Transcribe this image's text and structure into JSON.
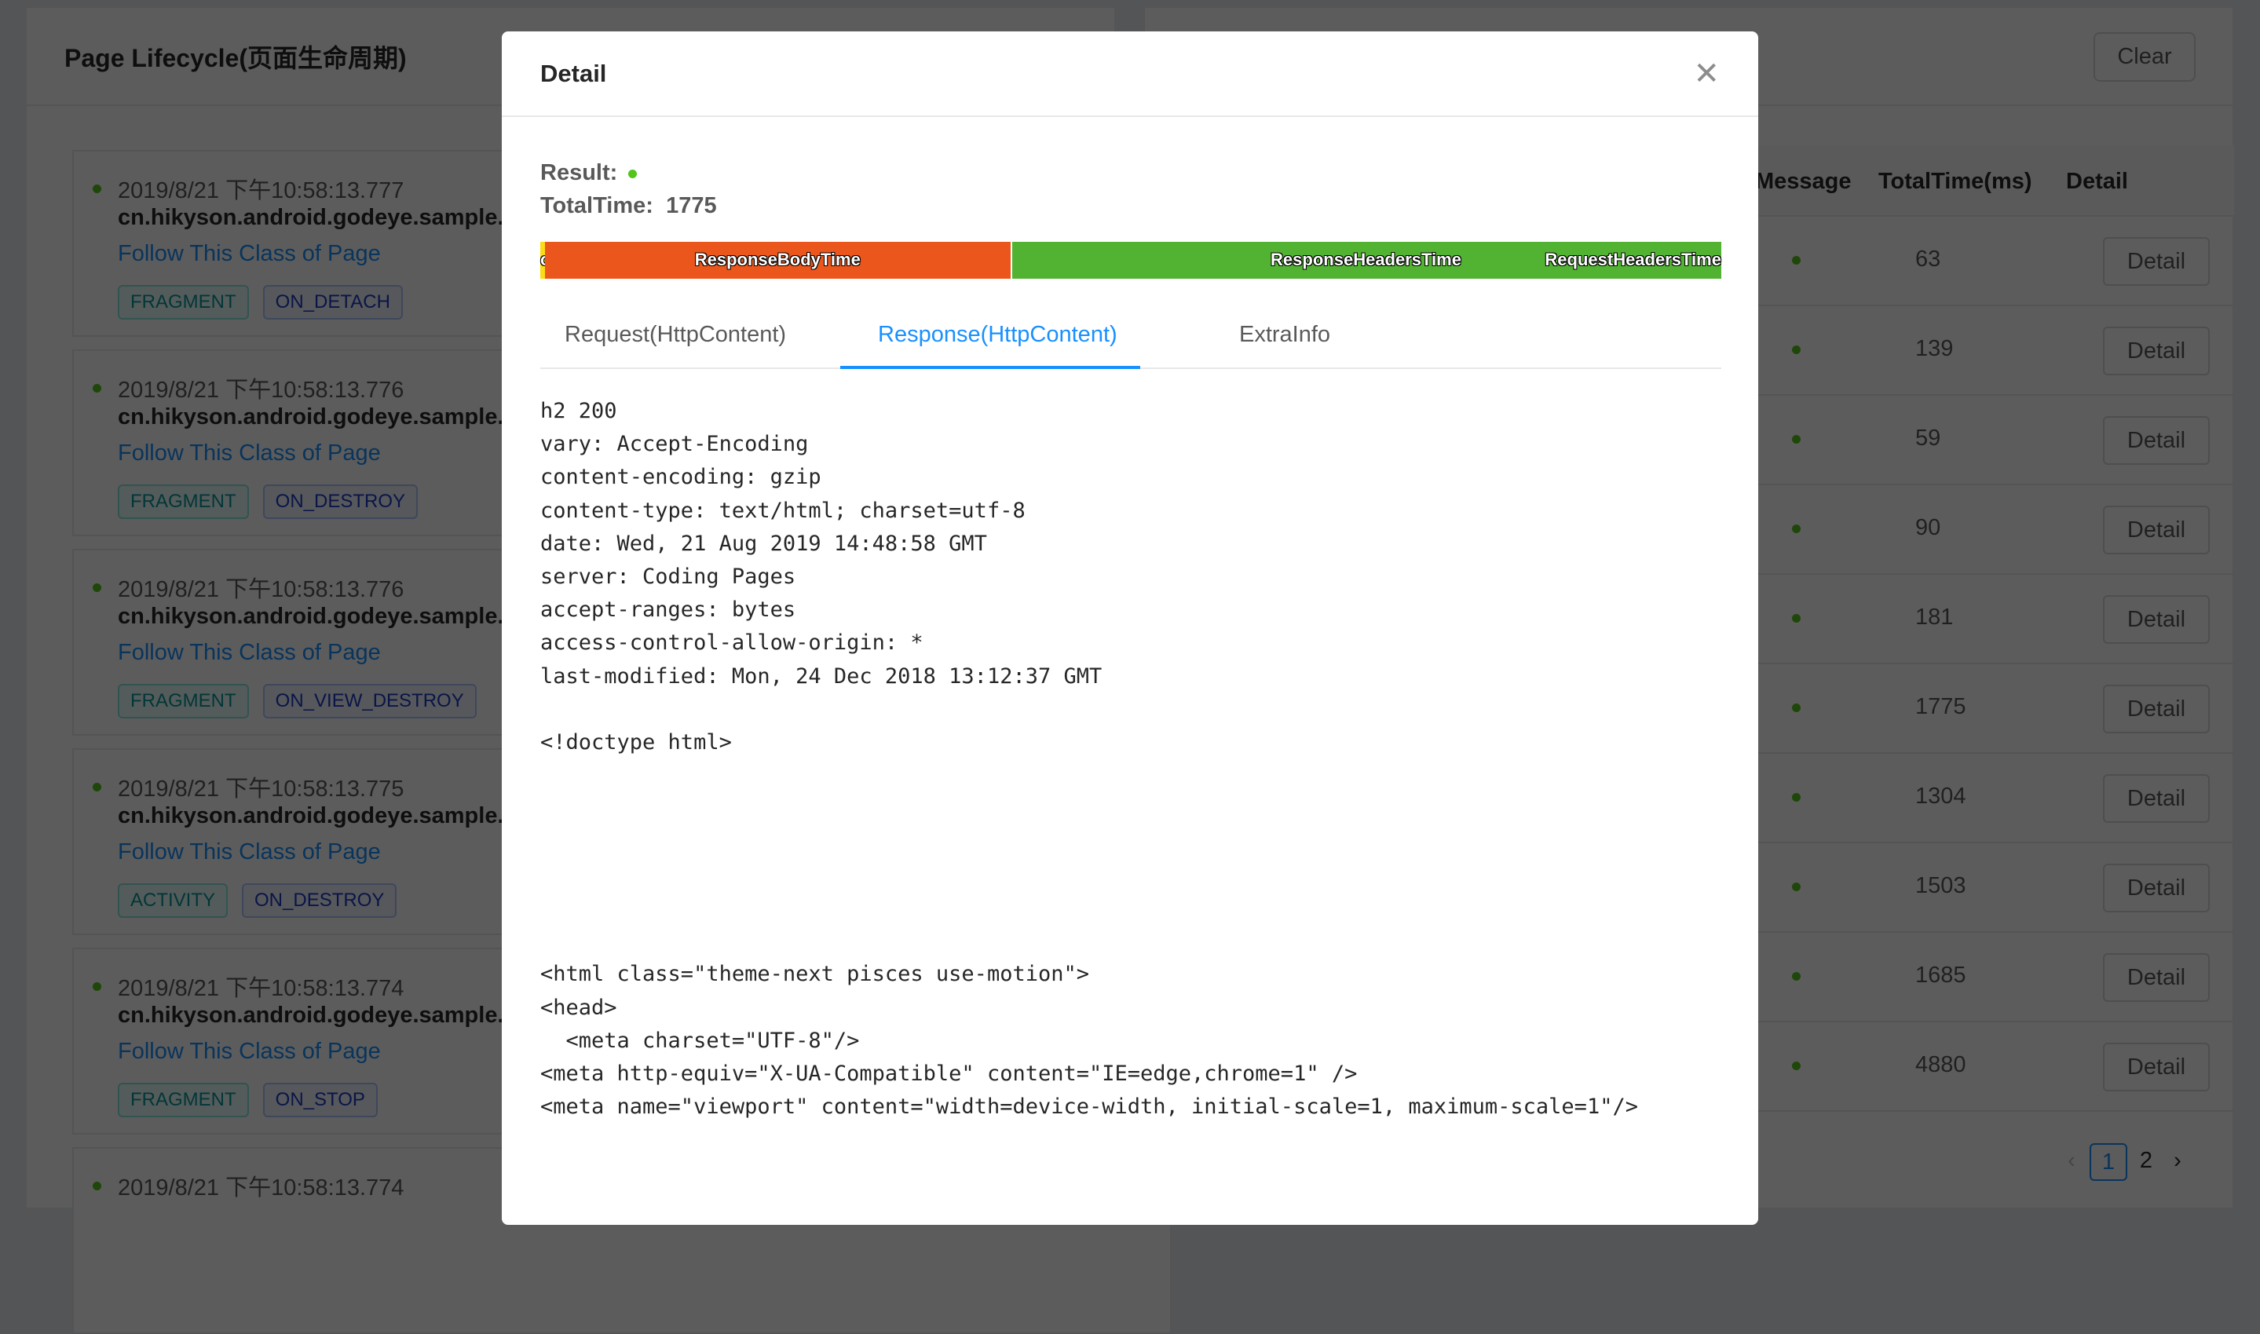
{
  "left_panel": {
    "title": "Page Lifecycle(页面生命周期)",
    "items": [
      {
        "time": "2019/8/21 下午10:58:13.777",
        "class": "cn.hikyson.android.godeye.sample.",
        "link": "Follow This Class of Page",
        "type": "FRAGMENT",
        "event": "ON_DETACH"
      },
      {
        "time": "2019/8/21 下午10:58:13.776",
        "class": "cn.hikyson.android.godeye.sample.",
        "link": "Follow This Class of Page",
        "type": "FRAGMENT",
        "event": "ON_DESTROY"
      },
      {
        "time": "2019/8/21 下午10:58:13.776",
        "class": "cn.hikyson.android.godeye.sample.",
        "link": "Follow This Class of Page",
        "type": "FRAGMENT",
        "event": "ON_VIEW_DESTROY"
      },
      {
        "time": "2019/8/21 下午10:58:13.775",
        "class": "cn.hikyson.android.godeye.sample.",
        "link": "Follow This Class of Page",
        "type": "ACTIVITY",
        "event": "ON_DESTROY"
      },
      {
        "time": "2019/8/21 下午10:58:13.774",
        "class": "cn.hikyson.android.godeye.sample.",
        "link": "Follow This Class of Page",
        "type": "FRAGMENT",
        "event": "ON_STOP"
      },
      {
        "time": "2019/8/21 下午10:58:13.774"
      }
    ]
  },
  "right_panel": {
    "clear_label": "Clear",
    "columns": {
      "message": "Message",
      "total_time": "TotalTime(ms)",
      "detail": "Detail"
    },
    "rows": [
      {
        "total_time": "63",
        "detail": "Detail"
      },
      {
        "total_time": "139",
        "detail": "Detail"
      },
      {
        "total_time": "59",
        "detail": "Detail"
      },
      {
        "total_time": "90",
        "detail": "Detail"
      },
      {
        "total_time": "181",
        "detail": "Detail"
      },
      {
        "total_time": "1775",
        "detail": "Detail"
      },
      {
        "total_time": "1304",
        "detail": "Detail"
      },
      {
        "total_time": "1503",
        "detail": "Detail"
      },
      {
        "total_time": "1685",
        "detail": "Detail"
      },
      {
        "total_time": "4880",
        "detail": "Detail"
      }
    ],
    "pagination": {
      "prev": "‹",
      "pages": [
        "1",
        "2"
      ],
      "current": "1",
      "next": "›"
    }
  },
  "modal": {
    "title": "Detail",
    "close_icon": "close-icon",
    "result_label": "Result:",
    "result_status_color": "#52c41a",
    "total_time_label": "TotalTime:",
    "total_time_value": "1775",
    "timing_bar": [
      {
        "label": "otherTime",
        "share": 0.004,
        "color": "#fadb14"
      },
      {
        "label": "ResponseBodyTime",
        "share": 0.394,
        "color": "#eb561d"
      },
      {
        "label": "ResponseHeadersTime",
        "share": 0.601,
        "color": "#52b333"
      },
      {
        "label": "RequestHeadersTime",
        "share": 0.001,
        "color": "#52b333"
      }
    ],
    "tabs": [
      {
        "label": "Request(HttpContent)"
      },
      {
        "label": "Response(HttpContent)",
        "active": true
      },
      {
        "label": "ExtraInfo"
      }
    ],
    "response_content": "h2 200\nvary: Accept-Encoding\ncontent-encoding: gzip\ncontent-type: text/html; charset=utf-8\ndate: Wed, 21 Aug 2019 14:48:58 GMT\nserver: Coding Pages\naccept-ranges: bytes\naccess-control-allow-origin: *\nlast-modified: Mon, 24 Dec 2018 13:12:37 GMT\n\n<!doctype html>\n\n\n\n\n\n\n<html class=\"theme-next pisces use-motion\">\n<head>\n  <meta charset=\"UTF-8\"/>\n<meta http-equiv=\"X-UA-Compatible\" content=\"IE=edge,chrome=1\" />\n<meta name=\"viewport\" content=\"width=device-width, initial-scale=1, maximum-scale=1\"/>"
  }
}
